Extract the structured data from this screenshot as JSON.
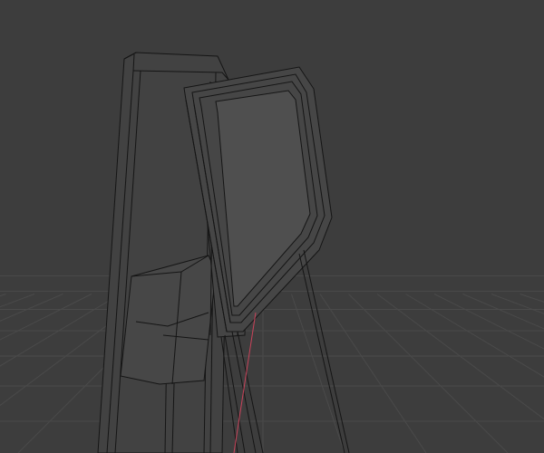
{
  "viewport": {
    "background_color": "#3d3d3d",
    "grid_color": "#4a4a4a",
    "wire_color": "#111111",
    "axis_x_color": "#c8435a",
    "panel_fill_color": "#4b4b4b"
  }
}
